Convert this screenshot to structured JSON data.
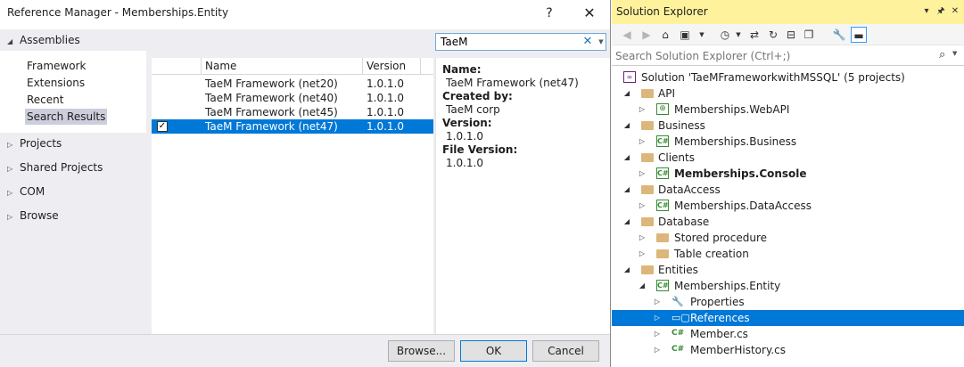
{
  "dialog": {
    "title": "Reference Manager - Memberships.Entity",
    "help_glyph": "?",
    "close_glyph": "✕",
    "nav": {
      "assemblies": "Assemblies",
      "assembly_items": [
        "Framework",
        "Extensions",
        "Recent",
        "Search Results"
      ],
      "projects": "Projects",
      "shared_projects": "Shared Projects",
      "com": "COM",
      "browse": "Browse"
    },
    "search": {
      "value": "TaeM",
      "clear_glyph": "✕"
    },
    "results": {
      "columns": [
        "Name",
        "Version"
      ],
      "rows": [
        {
          "name": "TaeM Framework (net20)",
          "version": "1.0.1.0",
          "checked": false,
          "selected": false
        },
        {
          "name": "TaeM Framework (net40)",
          "version": "1.0.1.0",
          "checked": false,
          "selected": false
        },
        {
          "name": "TaeM Framework (net45)",
          "version": "1.0.1.0",
          "checked": false,
          "selected": false
        },
        {
          "name": "TaeM Framework (net47)",
          "version": "1.0.1.0",
          "checked": true,
          "selected": true
        }
      ]
    },
    "details": {
      "name_label": "Name:",
      "name_value": "TaeM Framework (net47)",
      "created_label": "Created by:",
      "created_value": "TaeM corp",
      "version_label": "Version:",
      "version_value": "1.0.1.0",
      "file_version_label": "File Version:",
      "file_version_value": "1.0.1.0"
    },
    "buttons": {
      "browse": "Browse...",
      "ok": "OK",
      "cancel": "Cancel"
    }
  },
  "solution_explorer": {
    "title": "Solution Explorer",
    "search_placeholder": "Search Solution Explorer (Ctrl+;)",
    "accent_color": "#fff29d",
    "selection_color": "#0078d7",
    "tree": [
      {
        "label": "Solution 'TaeMFrameworkwithMSSQL' (5 projects)",
        "icon": "solution-icon",
        "level": 0,
        "expander": "",
        "bold": false
      },
      {
        "label": "API",
        "icon": "folder-icon",
        "level": 1,
        "expander": "open",
        "bold": false
      },
      {
        "label": "Memberships.WebAPI",
        "icon": "web-project-icon",
        "level": 2,
        "expander": "closed",
        "bold": false
      },
      {
        "label": "Business",
        "icon": "folder-icon",
        "level": 1,
        "expander": "open",
        "bold": false
      },
      {
        "label": "Memberships.Business",
        "icon": "csharp-project-icon",
        "level": 2,
        "expander": "closed",
        "bold": false
      },
      {
        "label": "Clients",
        "icon": "folder-icon",
        "level": 1,
        "expander": "open",
        "bold": false
      },
      {
        "label": "Memberships.Console",
        "icon": "csharp-project-icon",
        "level": 2,
        "expander": "closed",
        "bold": true
      },
      {
        "label": "DataAccess",
        "icon": "folder-icon",
        "level": 1,
        "expander": "open",
        "bold": false
      },
      {
        "label": "Memberships.DataAccess",
        "icon": "csharp-project-icon",
        "level": 2,
        "expander": "closed",
        "bold": false
      },
      {
        "label": "Database",
        "icon": "folder-icon",
        "level": 1,
        "expander": "open",
        "bold": false
      },
      {
        "label": "Stored procedure",
        "icon": "folder-icon",
        "level": 2,
        "expander": "closed",
        "bold": false
      },
      {
        "label": "Table creation",
        "icon": "folder-icon",
        "level": 2,
        "expander": "closed",
        "bold": false
      },
      {
        "label": "Entities",
        "icon": "folder-icon",
        "level": 1,
        "expander": "open",
        "bold": false
      },
      {
        "label": "Memberships.Entity",
        "icon": "csharp-project-icon",
        "level": 2,
        "expander": "open",
        "bold": false
      },
      {
        "label": "Properties",
        "icon": "wrench-icon",
        "level": 3,
        "expander": "closed",
        "bold": false
      },
      {
        "label": "References",
        "icon": "references-icon",
        "level": 3,
        "expander": "closed",
        "bold": false,
        "selected": true
      },
      {
        "label": "Member.cs",
        "icon": "csharp-file-icon",
        "level": 3,
        "expander": "closed",
        "bold": false
      },
      {
        "label": "MemberHistory.cs",
        "icon": "csharp-file-icon",
        "level": 3,
        "expander": "closed",
        "bold": false
      }
    ]
  }
}
